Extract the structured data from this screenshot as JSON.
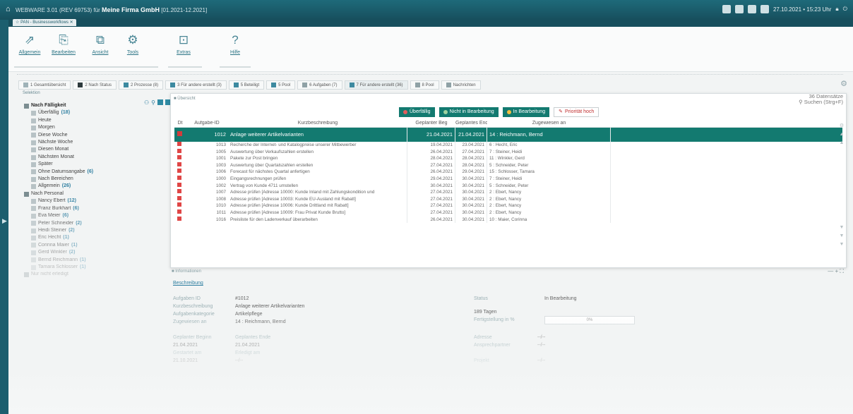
{
  "app": {
    "title_prefix": "WEBWARE 3.01 (REV 69753) für",
    "company": "Meine Firma GmbH",
    "period": "[01.2021-12.2021]",
    "datetime": "27.10.2021 • 15:23 Uhr",
    "tab": "PAN - Businessworkflows"
  },
  "ribbon": [
    {
      "label": "Allgemein",
      "icon": "arrow-icon"
    },
    {
      "label": "Bearbeiten",
      "icon": "edit-icon"
    },
    {
      "label": "Ansicht",
      "icon": "view-icon"
    },
    {
      "label": "Tools",
      "icon": "gears-icon"
    },
    {
      "label": "Extras",
      "icon": "extras-icon"
    },
    {
      "label": "Hilfe",
      "icon": "help-icon"
    }
  ],
  "window_tabs": [
    "1 Gesamtübersicht",
    "2 Nach Status",
    "2 Prozesse (8)",
    "3 Für andere erstellt (3)",
    "5 Beteiligt",
    "5 Pool",
    "6 Aufgaben (7)",
    "7 Für andere erstellt (36)",
    "8 Pool",
    "Nachrichten"
  ],
  "sidebar": {
    "header": "Selektion",
    "tree": [
      {
        "label": "Nach Fälligkeit",
        "count": "",
        "level": 0,
        "head": true
      },
      {
        "label": "Überfällig",
        "count": "(18)",
        "level": 1
      },
      {
        "label": "Heute",
        "count": "",
        "level": 1
      },
      {
        "label": "Morgen",
        "count": "",
        "level": 1
      },
      {
        "label": "Diese Woche",
        "count": "",
        "level": 1
      },
      {
        "label": "Nächste Woche",
        "count": "",
        "level": 1
      },
      {
        "label": "Diesen Monat",
        "count": "",
        "level": 1
      },
      {
        "label": "Nächsten Monat",
        "count": "",
        "level": 1
      },
      {
        "label": "Später",
        "count": "",
        "level": 1
      },
      {
        "label": "Ohne Datumsangabe",
        "count": "(6)",
        "level": 1
      },
      {
        "label": "Nach Bereichen",
        "count": "",
        "level": 1
      },
      {
        "label": "Allgemein",
        "count": "(26)",
        "level": 1
      },
      {
        "label": "Nach Personal",
        "count": "",
        "level": 0
      },
      {
        "label": "Nancy Ebert",
        "count": "(12)",
        "level": 1
      },
      {
        "label": "Franz Burkhart",
        "count": "(6)",
        "level": 1
      },
      {
        "label": "Eva Meier",
        "count": "(6)",
        "level": 1
      },
      {
        "label": "Peter Schneider",
        "count": "(2)",
        "level": 1
      },
      {
        "label": "Heidi Steiner",
        "count": "(2)",
        "level": 1
      },
      {
        "label": "Eric Hecht",
        "count": "(1)",
        "level": 1
      },
      {
        "label": "Corinna Maier",
        "count": "(1)",
        "level": 1
      },
      {
        "label": "Gerd Winkler",
        "count": "(2)",
        "level": 1
      },
      {
        "label": "Bernd Reichmann",
        "count": "(1)",
        "level": 1
      },
      {
        "label": "Tamara Schlosser",
        "count": "(1)",
        "level": 1
      },
      {
        "label": "Nur nicht erledigt",
        "count": "",
        "level": 0
      }
    ]
  },
  "main": {
    "title": "Übersicht",
    "count": "36 Datensätze",
    "search": "Suchen (Strg+F)",
    "filters": [
      {
        "label": "Überfällig",
        "dot": "#e25d5d"
      },
      {
        "label": "Nicht in Bearbeitung",
        "dot": "#9ed2a0"
      },
      {
        "label": "In Bearbeitung",
        "dot": "#f2c040"
      }
    ],
    "priority": "Priorität hoch",
    "columns": [
      "Dt",
      "Aufgabe-ID",
      "Kurzbeschreibung",
      "Geplanter Beg",
      "Geplantes End",
      "Zugewiesen an"
    ],
    "rows": [
      {
        "id": "1012",
        "desc": "Anlage weiterer Artikelvarianten",
        "begin": "21.04.2021",
        "end": "21.04.2021",
        "assigned": "14 : Reichmann, Bernd"
      },
      {
        "id": "1013",
        "desc": "Recherche der Internet- und Katalogpreise unserer Mitbewerber",
        "begin": "19.04.2021",
        "end": "23.04.2021",
        "assigned": "6 : Hecht, Eric"
      },
      {
        "id": "1005",
        "desc": "Auswertung über Verkaufszahlen erstellen",
        "begin": "26.04.2021",
        "end": "27.04.2021",
        "assigned": "7 : Steiner, Heidi"
      },
      {
        "id": "1001",
        "desc": "Pakete zur Post bringen",
        "begin": "28.04.2021",
        "end": "28.04.2021",
        "assigned": "11 : Winkler, Gerd"
      },
      {
        "id": "1003",
        "desc": "Auswertung über Quartalszahlen erstellen",
        "begin": "27.04.2021",
        "end": "28.04.2021",
        "assigned": "5 : Schneider, Peter"
      },
      {
        "id": "1006",
        "desc": "Forecast für nächstes Quartal anfertigen",
        "begin": "26.04.2021",
        "end": "29.04.2021",
        "assigned": "15 : Schlosser, Tamara"
      },
      {
        "id": "1000",
        "desc": "Eingangsrechnungen prüfen",
        "begin": "29.04.2021",
        "end": "30.04.2021",
        "assigned": "7 : Steiner, Heidi"
      },
      {
        "id": "1002",
        "desc": "Vertrag von Kunde 4711 umstellen",
        "begin": "30.04.2021",
        "end": "30.04.2021",
        "assigned": "5 : Schneider, Peter"
      },
      {
        "id": "1007",
        "desc": "Adresse prüfen [Adresse 10000: Kunde Inland mit Zahlungskondition und",
        "begin": "27.04.2021",
        "end": "30.04.2021",
        "assigned": "2 : Ebert, Nancy"
      },
      {
        "id": "1008",
        "desc": "Adresse prüfen [Adresse 10003: Kunde EU-Ausland mit Rabatt]",
        "begin": "27.04.2021",
        "end": "30.04.2021",
        "assigned": "2 : Ebert, Nancy"
      },
      {
        "id": "1010",
        "desc": "Adresse prüfen [Adresse 10006: Kunde Drittland mit Rabatt]",
        "begin": "27.04.2021",
        "end": "30.04.2021",
        "assigned": "2 : Ebert, Nancy"
      },
      {
        "id": "1011",
        "desc": "Adresse prüfen [Adresse 10009: Frau Privat Kunde Brutto]",
        "begin": "27.04.2021",
        "end": "30.04.2021",
        "assigned": "2 : Ebert, Nancy"
      },
      {
        "id": "1016",
        "desc": "Preisliste für den Ladenverkauf überarbeiten",
        "begin": "26.04.2021",
        "end": "30.04.2021",
        "assigned": "10 : Maier, Corinna"
      }
    ]
  },
  "info": {
    "header": "Informationen",
    "tab": "Beschreibung",
    "fields": {
      "id_label": "Aufgaben ID",
      "id": "#1012",
      "desc_label": "Kurzbeschreibung",
      "desc": "Anlage weiterer Artikelvarianten",
      "cat_label": "Aufgabenkategorie",
      "cat": "Artikelpflege",
      "assigned_label": "Zugewiesen an",
      "assigned": "14 : Reichmann, Bernd",
      "status_label": "Status",
      "status": "In Bearbeitung",
      "days": "189 Tagen",
      "progress_label": "Fertigstellung in %",
      "progress": "0%",
      "plan_begin_label": "Geplanter Beginn",
      "plan_begin": "21.04.2021",
      "plan_end_label": "Geplantes Ende",
      "plan_end": "21.04.2021",
      "started_label": "Gestartet am",
      "started": "Erledigt am",
      "date4": "21.10.2021",
      "dash": "--/--",
      "adresse_label": "Adresse",
      "adresse": "--/--",
      "contact_label": "Ansprechpartner",
      "contact": "--/--",
      "project_label": "Projekt",
      "project": "--/--"
    }
  }
}
